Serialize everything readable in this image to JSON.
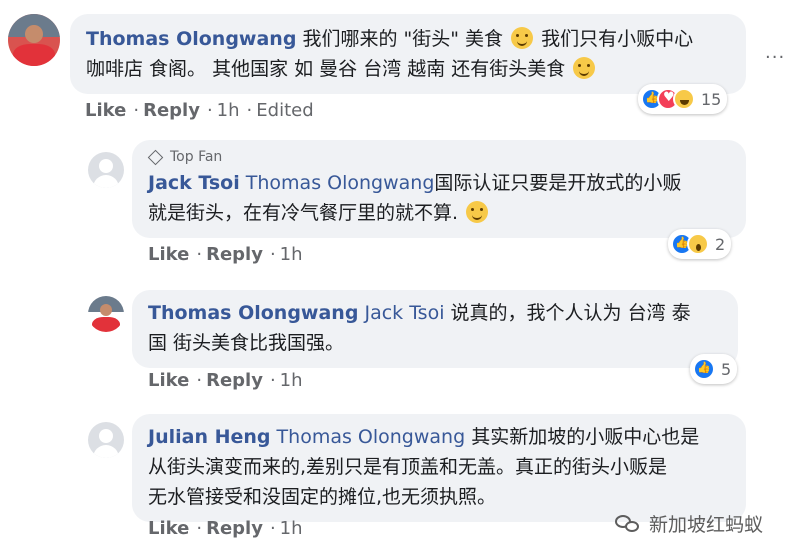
{
  "comments": [
    {
      "author": "Thomas Olongwang",
      "text_a": "我们哪来的 \"街头\" 美食",
      "text_b": "我们只有小贩中心",
      "text_line2": "咖啡店 食阁。 其他国家 如 曼谷 台湾 越南 还有街头美食",
      "actions": {
        "like": "Like",
        "reply": "Reply",
        "time": "1h",
        "edited": "Edited"
      },
      "reaction_count": "15",
      "more": "···"
    },
    {
      "badge": "Top Fan",
      "author": "Jack Tsoi",
      "mention": "Thomas Olongwang",
      "text_line1": "国际认证只要是开放式的小贩",
      "text_line2": "就是街头，在有冷气餐厅里的就不算.",
      "actions": {
        "like": "Like",
        "reply": "Reply",
        "time": "1h"
      },
      "reaction_count": "2"
    },
    {
      "author": "Thomas Olongwang",
      "mention": "Jack Tsoi",
      "text_line1": "说真的，我个人认为 台湾 泰",
      "text_line2": "国 街头美食比我国强。",
      "actions": {
        "like": "Like",
        "reply": "Reply",
        "time": "1h"
      },
      "reaction_count": "5"
    },
    {
      "author": "Julian Heng",
      "mention": "Thomas Olongwang",
      "text_line1": "其实新加坡的小贩中心也是",
      "text_line2": "从街头演变而来的,差别只是有顶盖和无盖。真正的街头小贩是",
      "text_line3": "无水管接受和没固定的摊位,也无须执照。",
      "actions": {
        "like": "Like",
        "reply": "Reply",
        "time": "1h"
      }
    }
  ],
  "watermark": "新加坡红蚂蚁",
  "colors": {
    "link": "#385898",
    "bubble": "#f0f2f5",
    "meta": "#65676b"
  }
}
